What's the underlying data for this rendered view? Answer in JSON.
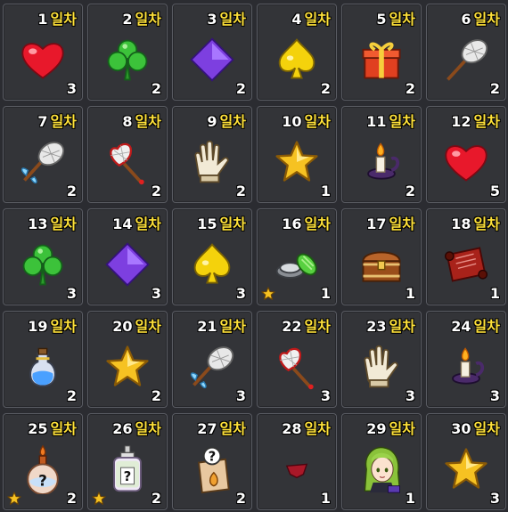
{
  "day_suffix": "일차",
  "days": [
    {
      "day": "1",
      "item": "heart-icon",
      "count": "3",
      "star": false
    },
    {
      "day": "2",
      "item": "clover-icon",
      "count": "2",
      "star": false
    },
    {
      "day": "3",
      "item": "diamond-icon",
      "count": "2",
      "star": false
    },
    {
      "day": "4",
      "item": "spade-icon",
      "count": "2",
      "star": false
    },
    {
      "day": "5",
      "item": "gift-box-icon",
      "count": "2",
      "star": false
    },
    {
      "day": "6",
      "item": "net-icon",
      "count": "2",
      "star": false
    },
    {
      "day": "7",
      "item": "winged-net-icon",
      "count": "2",
      "star": false
    },
    {
      "day": "8",
      "item": "heart-net-icon",
      "count": "2",
      "star": false
    },
    {
      "day": "9",
      "item": "glove-icon",
      "count": "2",
      "star": false
    },
    {
      "day": "10",
      "item": "star-icon",
      "count": "1",
      "star": false
    },
    {
      "day": "11",
      "item": "candle-icon",
      "count": "2",
      "star": false
    },
    {
      "day": "12",
      "item": "heart-icon",
      "count": "5",
      "star": false
    },
    {
      "day": "13",
      "item": "clover-icon",
      "count": "3",
      "star": false
    },
    {
      "day": "14",
      "item": "diamond-icon",
      "count": "3",
      "star": false
    },
    {
      "day": "15",
      "item": "spade-icon",
      "count": "3",
      "star": false
    },
    {
      "day": "16",
      "item": "pressure-plate-icon",
      "count": "1",
      "star": true
    },
    {
      "day": "17",
      "item": "treasure-chest-icon",
      "count": "1",
      "star": false
    },
    {
      "day": "18",
      "item": "scroll-icon",
      "count": "1",
      "star": false
    },
    {
      "day": "19",
      "item": "potion-icon",
      "count": "2",
      "star": false
    },
    {
      "day": "20",
      "item": "star-icon",
      "count": "2",
      "star": false
    },
    {
      "day": "21",
      "item": "winged-net-icon",
      "count": "3",
      "star": false
    },
    {
      "day": "22",
      "item": "heart-net-icon",
      "count": "3",
      "star": false
    },
    {
      "day": "23",
      "item": "glove-icon",
      "count": "3",
      "star": false
    },
    {
      "day": "24",
      "item": "candle-icon",
      "count": "3",
      "star": false
    },
    {
      "day": "25",
      "item": "mystery-flask-icon",
      "count": "2",
      "star": true
    },
    {
      "day": "26",
      "item": "mystery-bottle-icon",
      "count": "2",
      "star": true
    },
    {
      "day": "27",
      "item": "mystery-bag-icon",
      "count": "2",
      "star": false
    },
    {
      "day": "28",
      "item": "red-cloth-icon",
      "count": "1",
      "star": false
    },
    {
      "day": "29",
      "item": "character-icon",
      "count": "1",
      "star": false
    },
    {
      "day": "30",
      "item": "star-icon",
      "count": "3",
      "star": false
    }
  ],
  "colors": {
    "background": "#2b2c31",
    "cell": "#333438",
    "cell_border": "#595b62",
    "day_suffix": "#ffe23a",
    "text": "#ffffff"
  }
}
